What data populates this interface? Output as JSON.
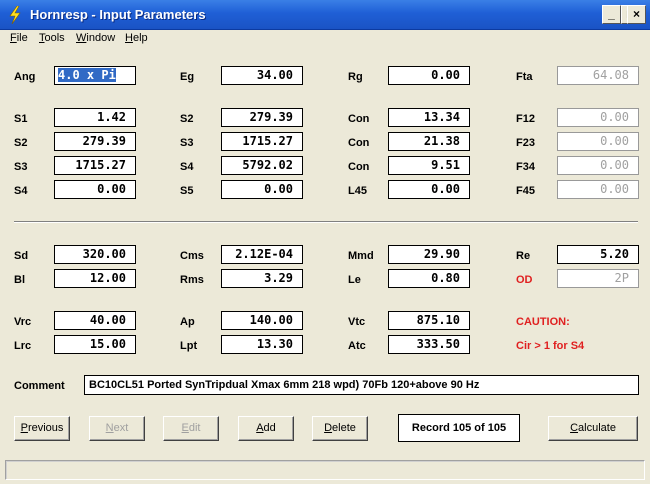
{
  "window": {
    "title": "Hornresp - Input Parameters",
    "minimize": "_",
    "close": "×"
  },
  "menu": {
    "file": {
      "u": "F",
      "rest": "ile"
    },
    "tools": {
      "u": "T",
      "rest": "ools"
    },
    "window": {
      "u": "W",
      "rest": "indow"
    },
    "help": {
      "u": "H",
      "rest": "elp"
    }
  },
  "params": {
    "ang": {
      "label": "Ang",
      "value": "4.0 x Pi"
    },
    "eg": {
      "label": "Eg",
      "value": "34.00"
    },
    "rg": {
      "label": "Rg",
      "value": "0.00"
    },
    "fta": {
      "label": "Fta",
      "value": "64.08"
    },
    "s1": {
      "label": "S1",
      "value": "1.42"
    },
    "s2a": {
      "label": "S2",
      "value": "279.39"
    },
    "con1": {
      "label": "Con",
      "value": "13.34"
    },
    "f12": {
      "label": "F12",
      "value": "0.00"
    },
    "s2b": {
      "label": "S2",
      "value": "279.39"
    },
    "s3a": {
      "label": "S3",
      "value": "1715.27"
    },
    "con2": {
      "label": "Con",
      "value": "21.38"
    },
    "f23": {
      "label": "F23",
      "value": "0.00"
    },
    "s3b": {
      "label": "S3",
      "value": "1715.27"
    },
    "s4a": {
      "label": "S4",
      "value": "5792.02"
    },
    "con3": {
      "label": "Con",
      "value": "9.51"
    },
    "f34": {
      "label": "F34",
      "value": "0.00"
    },
    "s4b": {
      "label": "S4",
      "value": "0.00"
    },
    "s5": {
      "label": "S5",
      "value": "0.00"
    },
    "l45": {
      "label": "L45",
      "value": "0.00"
    },
    "f45": {
      "label": "F45",
      "value": "0.00"
    },
    "sd": {
      "label": "Sd",
      "value": "320.00"
    },
    "cms": {
      "label": "Cms",
      "value": "2.12E-04"
    },
    "mmd": {
      "label": "Mmd",
      "value": "29.90"
    },
    "re": {
      "label": "Re",
      "value": "5.20"
    },
    "bl": {
      "label": "Bl",
      "value": "12.00"
    },
    "rms": {
      "label": "Rms",
      "value": "3.29"
    },
    "le": {
      "label": "Le",
      "value": "0.80"
    },
    "od": {
      "label": "OD",
      "value": "2P"
    },
    "vrc": {
      "label": "Vrc",
      "value": "40.00"
    },
    "ap": {
      "label": "Ap",
      "value": "140.00"
    },
    "vtc": {
      "label": "Vtc",
      "value": "875.10"
    },
    "lrc": {
      "label": "Lrc",
      "value": "15.00"
    },
    "lpt": {
      "label": "Lpt",
      "value": "13.30"
    },
    "atc": {
      "label": "Atc",
      "value": "333.50"
    }
  },
  "caution": {
    "title": "CAUTION:",
    "message": "Cir > 1 for S4"
  },
  "comment": {
    "label": "Comment",
    "value": "BC10CL51 Ported SynTripdual Xmax 6mm 218 wpd) 70Fb 120+above 90 Hz"
  },
  "buttons": {
    "previous": {
      "u": "P",
      "rest": "revious"
    },
    "next": {
      "u": "N",
      "rest": "ext"
    },
    "edit": {
      "u": "E",
      "rest": "dit"
    },
    "add": {
      "u": "A",
      "rest": "dd"
    },
    "delete": {
      "u": "D",
      "rest": "elete"
    },
    "calculate": {
      "u": "C",
      "rest": "alculate"
    }
  },
  "record": "Record 105 of 105",
  "colors": {
    "titlebar": "#1f5fd6",
    "warning": "#e02020",
    "selection": "#316ac5"
  }
}
